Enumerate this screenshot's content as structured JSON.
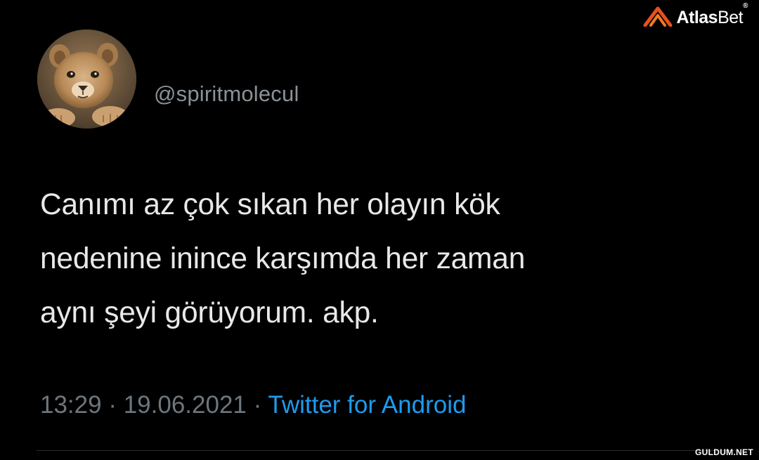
{
  "tweet": {
    "handle": "@spiritmolecul",
    "text_lines": [
      "Canımı az çok sıkan her olayın kök",
      "nedenine inince karşımda her zaman",
      "aynı şeyi görüyorum. akp."
    ],
    "time": "13:29",
    "separator": "·",
    "date": "19.06.2021",
    "source": "Twitter for Android"
  },
  "avatar": {
    "icon": "lion-cub-avatar"
  },
  "brand_logo": {
    "name_bold": "Atlas",
    "name_light": "Bet",
    "mark": "®",
    "icon": "atlasbet-logo-icon",
    "accent_color": "#e8501a"
  },
  "watermark": {
    "text": "GULDUM.NET"
  },
  "colors": {
    "background": "#000000",
    "text": "#e8e8e8",
    "muted": "#6e767d",
    "link": "#1d9bf0"
  }
}
